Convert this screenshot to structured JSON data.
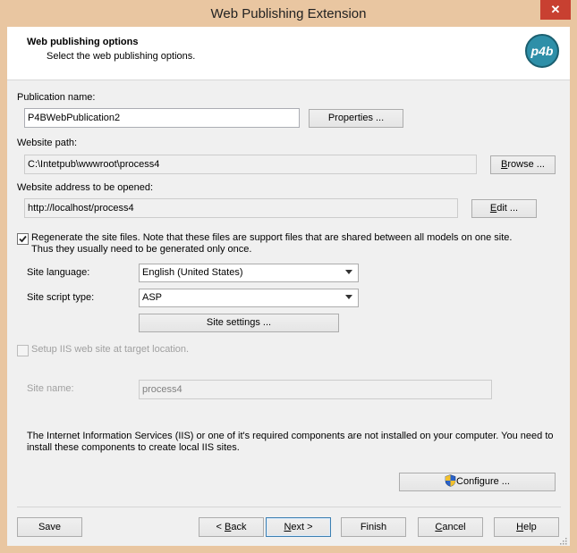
{
  "window": {
    "title": "Web Publishing Extension",
    "close_glyph": "✕"
  },
  "header": {
    "title": "Web publishing options",
    "subtitle": "Select the web publishing options.",
    "logo_text": "p4b"
  },
  "publication": {
    "label": "Publication name:",
    "value": "P4BWebPublication2",
    "properties_button": "Properties ..."
  },
  "website_path": {
    "label": "Website path:",
    "value": "C:\\Intetpub\\wwwroot\\process4",
    "browse_button_prefix": "",
    "browse_button_accel": "B",
    "browse_button_rest": "rowse ..."
  },
  "website_address": {
    "label": "Website address to be opened:",
    "value": "http://localhost/process4",
    "edit_button_prefix": "",
    "edit_button_accel": "E",
    "edit_button_rest": "dit ..."
  },
  "regenerate": {
    "checked": true,
    "line1": "Regenerate the site files. Note that these files are support files that are shared between all models on one site.",
    "line2": "Thus they usually need to be generated only once."
  },
  "site_language": {
    "label": "Site language:",
    "selected": "English (United States)"
  },
  "site_script_type": {
    "label": "Site script type:",
    "selected": "ASP"
  },
  "site_settings_button": "Site settings ...",
  "iis": {
    "setup_label": "Setup IIS web site at target location.",
    "setup_checked": false,
    "site_name_label": "Site name:",
    "site_name_value": "process4",
    "notice_line1": "The Internet Information Services (IIS) or one of it's required components are not installed on your computer. You need to",
    "notice_line2": "install these components to create local IIS sites.",
    "configure_button": "Configure ...",
    "shield_icon": "shield-icon"
  },
  "footer": {
    "save": "Save",
    "back_glyph": "< ",
    "back_accel": "B",
    "back_rest": "ack",
    "next_accel": "N",
    "next_rest": "ext >",
    "finish": "Finish",
    "cancel_accel": "C",
    "cancel_rest": "ancel",
    "help_accel": "H",
    "help_rest": "elp"
  },
  "colors": {
    "frame": "#e9c6a1",
    "client": "#f0f0f0",
    "close": "#c84031",
    "logo": "#2e8fa8"
  }
}
